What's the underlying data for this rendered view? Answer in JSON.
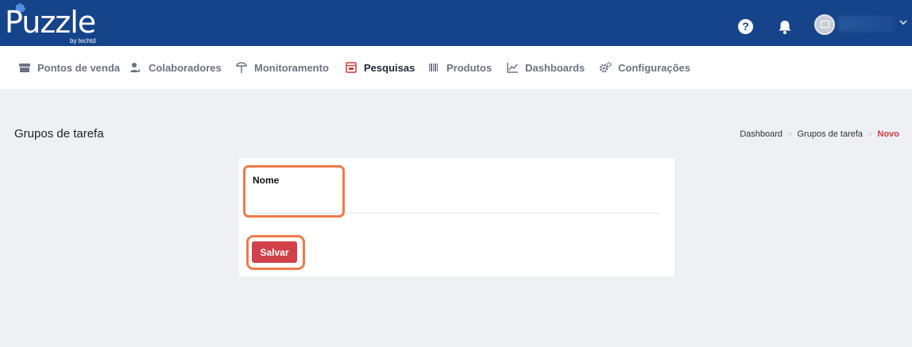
{
  "header": {
    "logo_text": "Puzzle",
    "logo_sub": "by techtd",
    "help_glyph": "?",
    "icons": [
      "help-icon",
      "bell-icon",
      "avatar",
      "chevron-down-icon"
    ]
  },
  "nav": {
    "items": [
      {
        "label": "Pontos de venda",
        "icon": "store-icon"
      },
      {
        "label": "Colaboradores",
        "icon": "users-icon"
      },
      {
        "label": "Monitoramento",
        "icon": "monitor-icon"
      },
      {
        "label": "Pesquisas",
        "icon": "survey-icon"
      },
      {
        "label": "Produtos",
        "icon": "barcode-icon"
      },
      {
        "label": "Dashboards",
        "icon": "chart-icon"
      },
      {
        "label": "Configurações",
        "icon": "gears-icon"
      }
    ],
    "active": "Pesquisas",
    "active_color": "#d23b3b"
  },
  "page": {
    "title": "Grupos de tarefa"
  },
  "breadcrumb": {
    "items": [
      "Dashboard",
      "Grupos de tarefa",
      "Novo"
    ],
    "separator": ">"
  },
  "form": {
    "name_label": "Nome",
    "name_value": "",
    "save_label": "Salvar"
  },
  "colors": {
    "topbar": "#16448a",
    "accent": "#d0414a",
    "highlight": "#ef7a46",
    "background": "#eef0f4"
  }
}
